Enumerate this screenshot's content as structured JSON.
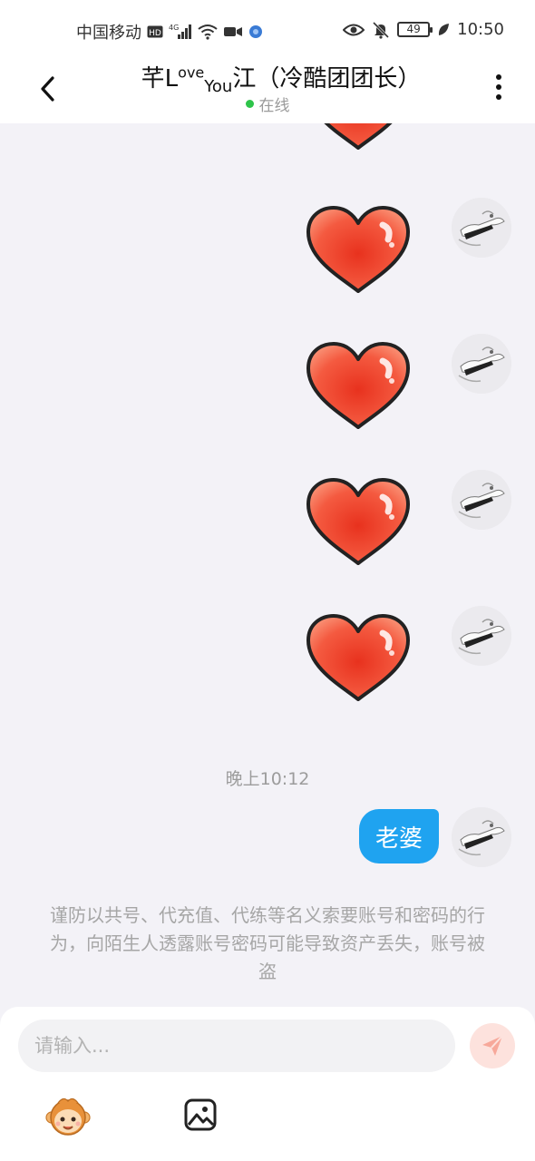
{
  "status_bar": {
    "carrier": "中国移动",
    "network_badge": "HD",
    "network_type": "4G",
    "battery": "49",
    "time": "10:50",
    "icons": [
      "hd-icon",
      "signal-icon",
      "wifi-icon",
      "video-icon",
      "app-icon",
      "eye-icon",
      "mute-bell-icon",
      "battery-icon",
      "leaf-icon"
    ]
  },
  "header": {
    "title_part1": "芊L",
    "title_sup": "ove",
    "title_sub": "You",
    "title_part2": "江（冷酷团团长）",
    "status": "在线",
    "status_color": "#2ec44a"
  },
  "chat": {
    "messages": [
      {
        "type": "sticker",
        "sticker": "red-heart"
      },
      {
        "type": "sticker",
        "sticker": "red-heart"
      },
      {
        "type": "sticker",
        "sticker": "red-heart"
      },
      {
        "type": "sticker",
        "sticker": "red-heart"
      },
      {
        "type": "sticker",
        "sticker": "red-heart"
      }
    ],
    "timestamp": "晚上10:12",
    "text_message": "老婆",
    "bubble_color": "#1fa3f0",
    "notice": "谨防以共号、代充值、代练等名义索要账号和密码的行为，向陌生人透露账号密码可能导致资产丢失，账号被盗"
  },
  "composer": {
    "placeholder": "请输入...",
    "send_icon": "send-icon",
    "tools": [
      "monkey-emoji-icon",
      "image-icon"
    ]
  }
}
